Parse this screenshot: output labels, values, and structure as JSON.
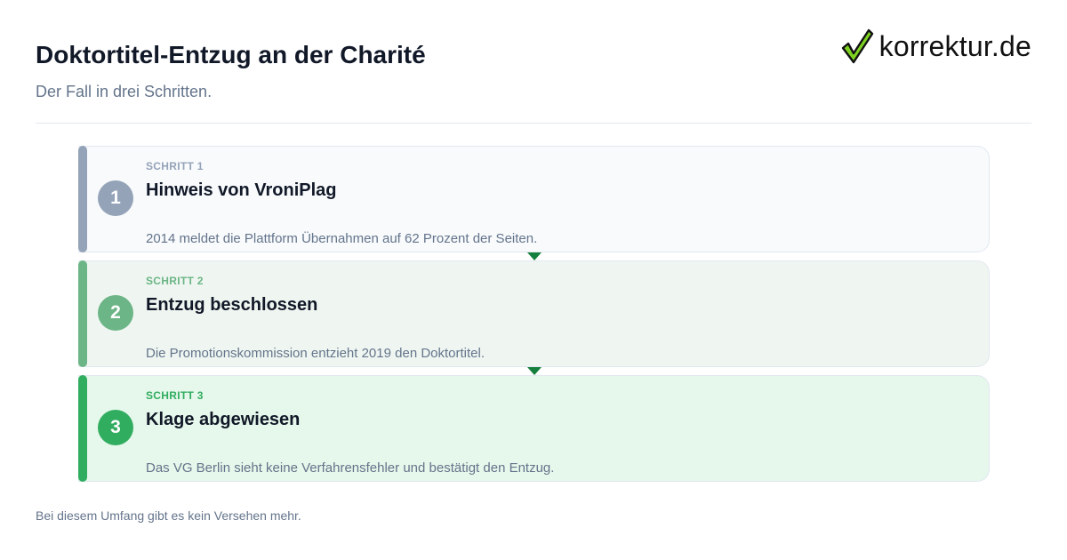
{
  "header": {
    "title": "Doktortitel-Entzug an der Charité",
    "subtitle": "Der Fall in drei Schritten."
  },
  "logo": {
    "icon": "checkmark-icon",
    "text": "korrektur.de"
  },
  "steps": [
    {
      "label": "SCHRITT 1",
      "number": "1",
      "heading": "Hinweis von VroniPlag",
      "description": "2014 meldet die Plattform Übernahmen auf 62 Prozent der Seiten.",
      "color": "#94a3b8"
    },
    {
      "label": "SCHRITT 2",
      "number": "2",
      "heading": "Entzug beschlossen",
      "description": "Die Promotionskommission entzieht 2019 den Doktortitel.",
      "color": "#6cb586"
    },
    {
      "label": "SCHRITT 3",
      "number": "3",
      "heading": "Klage abgewiesen",
      "description": "Das VG Berlin sieht keine Verfahrensfehler und bestätigt den Entzug.",
      "color": "#31ad60"
    }
  ],
  "footer": {
    "note": "Bei diesem Umfang gibt es kein Versehen mehr."
  },
  "colors": {
    "arrow": "#15803d",
    "title": "#111827",
    "muted": "#64748b"
  }
}
